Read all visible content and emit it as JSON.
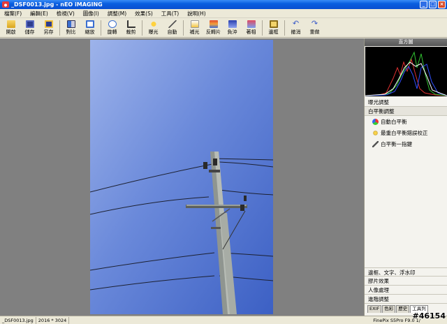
{
  "window": {
    "title": "_DSF0013.jpg - nEO iMAGING"
  },
  "menu": [
    "檔案(F)",
    "編輯(E)",
    "檢視(V)",
    "圖像(I)",
    "調整(M)",
    "效果(S)",
    "工具(T)",
    "說明(H)"
  ],
  "toolbar": {
    "open": "開啟",
    "save": "儲存",
    "saveas": "另存",
    "compare": "對比",
    "zoom": "縮放",
    "rotate": "旋轉",
    "crop": "裁剪",
    "exposure": "曝光",
    "auto": "自動",
    "fill": "補光",
    "reverse": "反轉片",
    "negative": "負沖",
    "color": "著相",
    "frame": "邊框",
    "undo": "撤消",
    "redo": "重做"
  },
  "panel": {
    "histogram_title": "直方圖",
    "exposure": "曝光調整",
    "wb": "白平衡調整",
    "options": [
      "自動白平衡",
      "最重白平衡錯誤校正",
      "白平衡一指鍵"
    ],
    "lower_sections": [
      "邊框、文字、浮水印",
      "膠片效果",
      "人像處理",
      "進階調整"
    ],
    "tabs": [
      "EXIF",
      "色彩",
      "歷史",
      "工具列"
    ]
  },
  "status": {
    "filename": "_DSF0013.jpg",
    "dimensions": "2016 * 3024",
    "camera": "FinePix S5Pro F9.0 1/",
    "watermark": "#46154"
  },
  "colors": {
    "titlebar": "#0a5fe0",
    "sky_top": "#7f9ae0",
    "sky_bottom": "#3e63c8"
  }
}
